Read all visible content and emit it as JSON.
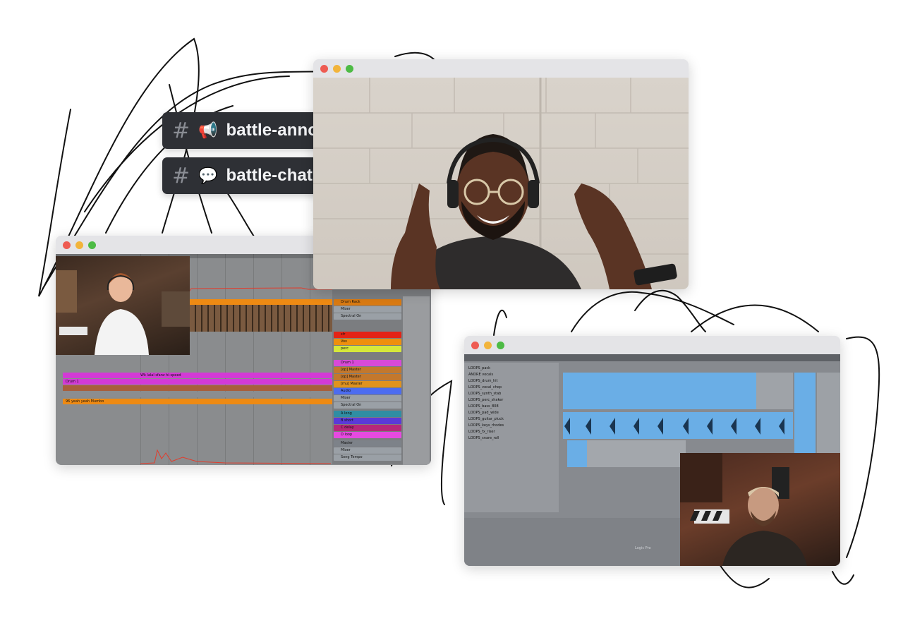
{
  "channels": [
    {
      "hash": "#",
      "emoji": "📢",
      "name": "battle-announcements"
    },
    {
      "hash": "#",
      "emoji": "💬",
      "name": "battle-chat"
    }
  ],
  "windows": {
    "video_call": {
      "traffic_lights": [
        "close",
        "minimize",
        "zoom"
      ]
    },
    "ableton": {
      "clip_labels": [
        "Wk lalal sfanz hi-speed",
        "Drum 1",
        "96 yeah yeah Mumbo"
      ],
      "mixer_tracks": [
        {
          "label": "Drum Rack",
          "color": "#d97a12"
        },
        {
          "label": "Mixer",
          "color": "#9aa0a6"
        },
        {
          "label": "Spectral On",
          "color": "#9aa0a6"
        },
        {
          "label": "sfr",
          "color": "#e32416"
        },
        {
          "label": "Vox",
          "color": "#ee8f0e"
        },
        {
          "label": "perc",
          "color": "#d6e83a"
        },
        {
          "label": "Drum 1",
          "color": "#d84ad8"
        },
        {
          "label": "[op] Master",
          "color": "#c3782d"
        },
        {
          "label": "[op] Master",
          "color": "#c3782d"
        },
        {
          "label": "[mu] Master",
          "color": "#e0931e"
        },
        {
          "label": "Audio",
          "color": "#4c6cf0"
        },
        {
          "label": "Mixer",
          "color": "#9aa0a6"
        },
        {
          "label": "Spectral On",
          "color": "#9aa0a6"
        },
        {
          "label": "A long",
          "color": "#2f8ea3"
        },
        {
          "label": "B short",
          "color": "#5a3ad8"
        },
        {
          "label": "C delay",
          "color": "#b6287a"
        },
        {
          "label": "D loop",
          "color": "#e64ae0"
        },
        {
          "label": "Master",
          "color": "#7d8289"
        },
        {
          "label": "Mixer",
          "color": "#9aa0a6"
        },
        {
          "label": "Song Tempo",
          "color": "#9aa0a6"
        }
      ]
    },
    "logic": {
      "file_list": [
        "LOOPS_pack",
        "ANDRE vocals",
        "LOOPS_drum_hit",
        "LOOPS_vocal_chop",
        "LOOPS_synth_stab",
        "LOOPS_perc_shaker",
        "LOOPS_bass_808",
        "LOOPS_pad_wide",
        "LOOPS_guitar_pluck",
        "LOOPS_keys_rhodes",
        "LOOPS_fx_riser",
        "LOOPS_snare_roll"
      ],
      "watermark": "Logic Pro"
    }
  },
  "colors": {
    "pill_bg": "#2e3035",
    "clip_blue": "#6aaee6",
    "clip_magenta": "#d33ad6",
    "clip_orange": "#ee8a13"
  }
}
